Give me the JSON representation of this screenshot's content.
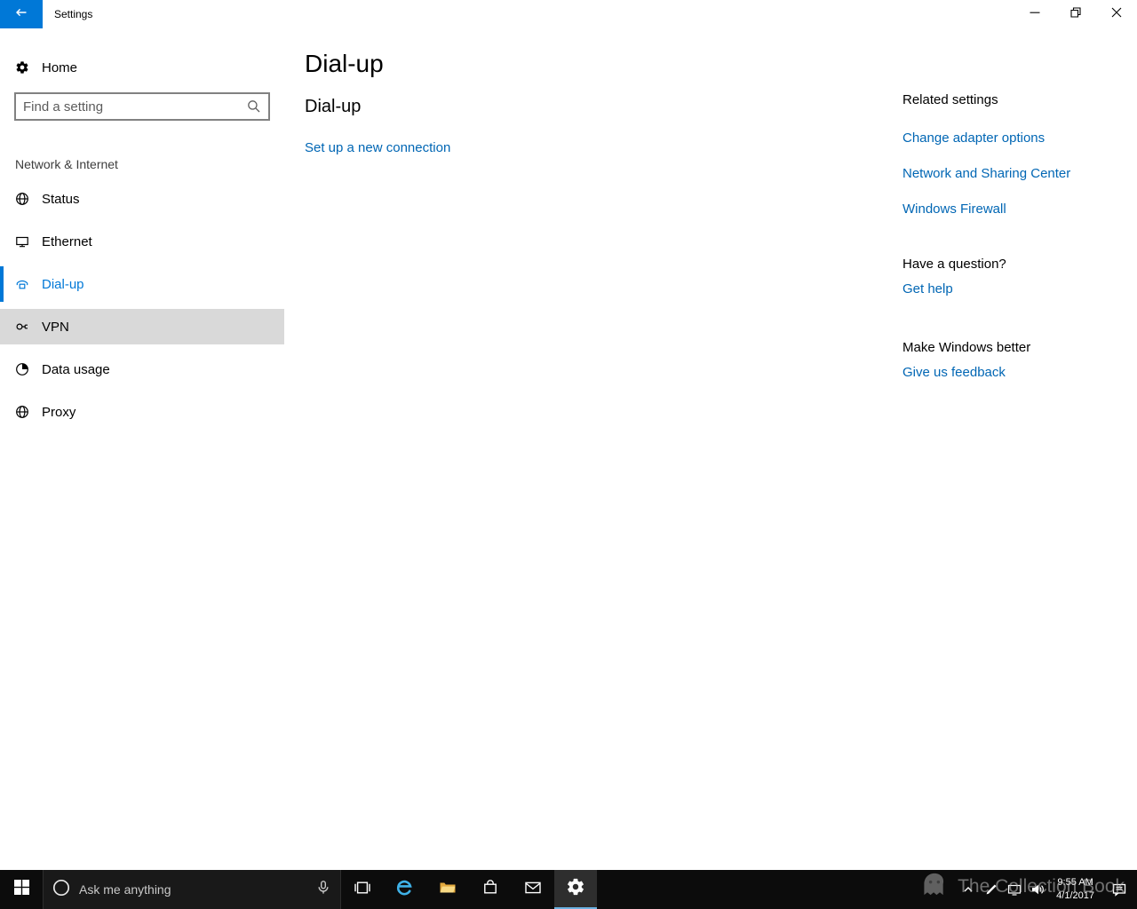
{
  "colors": {
    "accent": "#0078d7",
    "link": "#0066b4",
    "taskbar": "#0c0c0c"
  },
  "titlebar": {
    "title": "Settings"
  },
  "sidebar": {
    "home_label": "Home",
    "search_placeholder": "Find a setting",
    "section_label": "Network & Internet",
    "items": [
      {
        "label": "Status",
        "icon": "globe-icon",
        "state": "normal"
      },
      {
        "label": "Ethernet",
        "icon": "ethernet-icon",
        "state": "normal"
      },
      {
        "label": "Dial-up",
        "icon": "dialup-phone-icon",
        "state": "selected"
      },
      {
        "label": "VPN",
        "icon": "vpn-plug-icon",
        "state": "hover"
      },
      {
        "label": "Data usage",
        "icon": "pie-chart-icon",
        "state": "normal"
      },
      {
        "label": "Proxy",
        "icon": "globe-icon",
        "state": "normal"
      }
    ]
  },
  "main": {
    "page_title": "Dial-up",
    "section_heading": "Dial-up",
    "setup_link": "Set up a new connection"
  },
  "related": {
    "heading": "Related settings",
    "links": [
      {
        "label": "Change adapter options"
      },
      {
        "label": "Network and Sharing Center"
      },
      {
        "label": "Windows Firewall"
      }
    ],
    "question_heading": "Have a question?",
    "question_link": "Get help",
    "feedback_heading": "Make Windows better",
    "feedback_link": "Give us feedback"
  },
  "taskbar": {
    "search_placeholder": "Ask me anything",
    "time": "9:55 AM",
    "date": "4/1/2017"
  },
  "watermark": {
    "text": "The Collection Book"
  }
}
